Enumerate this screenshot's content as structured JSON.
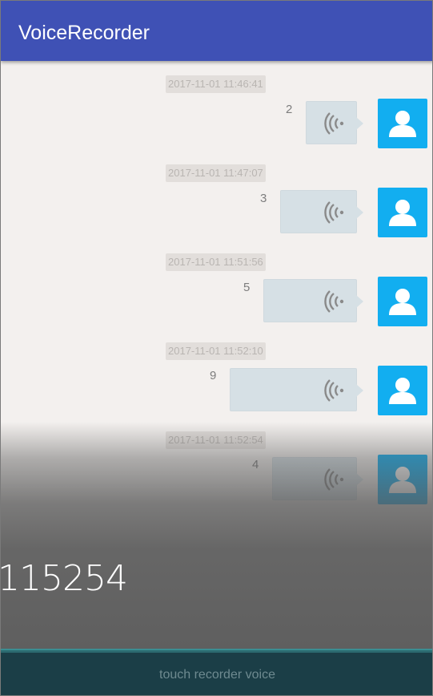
{
  "app": {
    "title": "VoiceRecorder"
  },
  "messages": [
    {
      "timestamp": "2017-11-01 11:46:41",
      "duration": "2"
    },
    {
      "timestamp": "2017-11-01 11:47:07",
      "duration": "3"
    },
    {
      "timestamp": "2017-11-01 11:51:56",
      "duration": "5"
    },
    {
      "timestamp": "2017-11-01 11:52:10",
      "duration": "9"
    },
    {
      "timestamp": "2017-11-01 11:52:54",
      "duration": "4"
    }
  ],
  "recording": {
    "counter": "115254"
  },
  "recorder_button": {
    "label": "touch recorder voice"
  },
  "icons": {
    "voice": "voice-wave-icon",
    "avatar": "user-avatar-icon"
  },
  "colors": {
    "appbar": "#3f51b5",
    "avatar": "#12aef0",
    "bubble": "#d6e0e5",
    "recorder_bar": "#1b3e47"
  }
}
